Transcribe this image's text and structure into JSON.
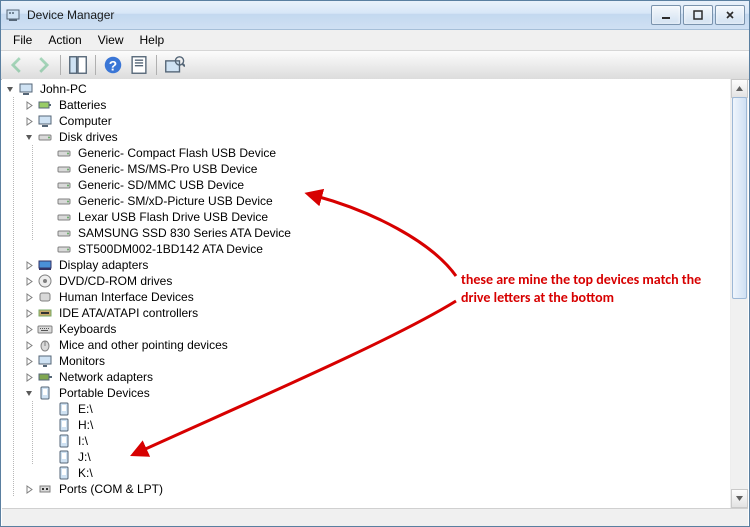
{
  "title": "Device Manager",
  "menu": {
    "file": "File",
    "action": "Action",
    "view": "View",
    "help": "Help"
  },
  "tree": {
    "root": "John-PC",
    "batteries": "Batteries",
    "computer": "Computer",
    "disk_drives": "Disk drives",
    "dd": {
      "d0": "Generic- Compact Flash USB Device",
      "d1": "Generic- MS/MS-Pro USB Device",
      "d2": "Generic- SD/MMC USB Device",
      "d3": "Generic- SM/xD-Picture USB Device",
      "d4": "Lexar USB Flash Drive USB Device",
      "d5": "SAMSUNG SSD 830 Series ATA Device",
      "d6": "ST500DM002-1BD142 ATA Device"
    },
    "display_adapters": "Display adapters",
    "dvd": "DVD/CD-ROM drives",
    "hid": "Human Interface Devices",
    "ide": "IDE ATA/ATAPI controllers",
    "keyboards": "Keyboards",
    "mice": "Mice and other pointing devices",
    "monitors": "Monitors",
    "network": "Network adapters",
    "portable": "Portable Devices",
    "pd": {
      "p0": "E:\\",
      "p1": "H:\\",
      "p2": "I:\\",
      "p3": "J:\\",
      "p4": "K:\\"
    },
    "ports": "Ports (COM & LPT)"
  },
  "annotation": {
    "line1": "these are mine the top devices match the",
    "line2": "drive letters at the bottom"
  }
}
